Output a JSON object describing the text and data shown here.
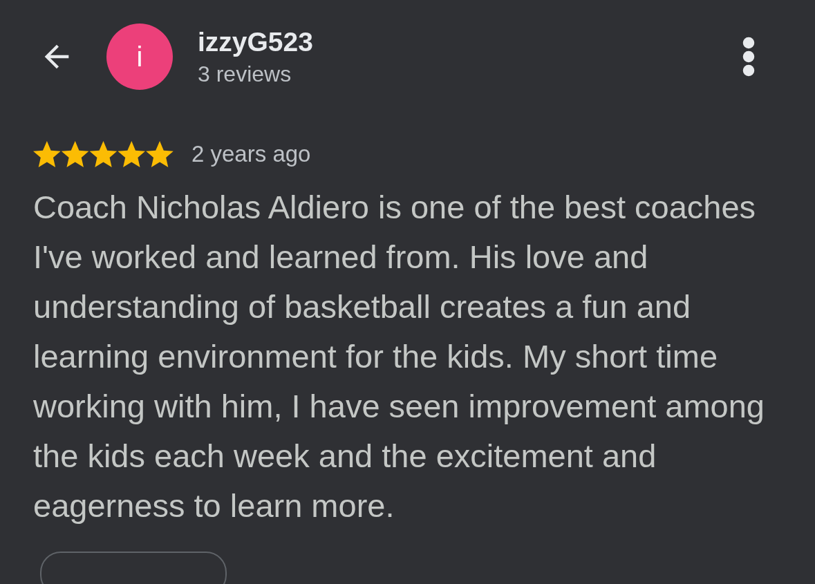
{
  "header": {
    "avatar_letter": "i",
    "username": "izzyG523",
    "subtitle": "3 reviews"
  },
  "review": {
    "stars": 5,
    "time": "2 years ago",
    "text": "Coach Nicholas Aldiero is one of the best coaches I've worked and learned from. His love and understanding of basketball creates a fun and learning environment for the kids. My short time working with him, I have seen improvement among the kids each week and the excitement and eagerness to learn more."
  }
}
